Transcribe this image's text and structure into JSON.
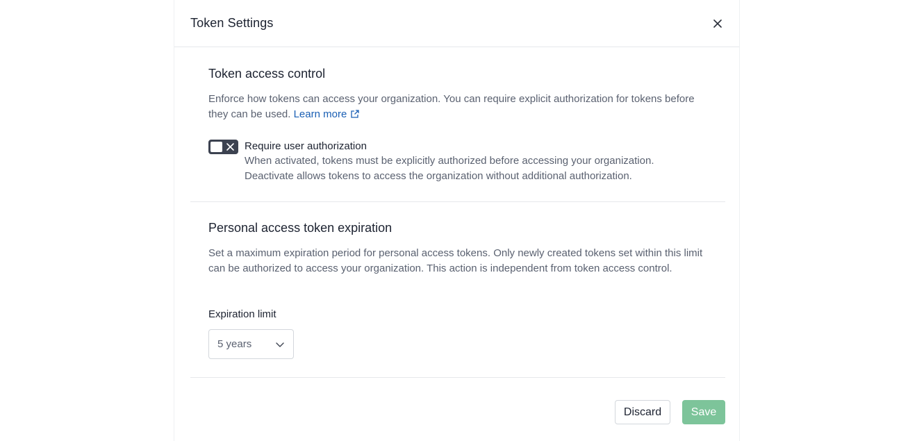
{
  "dialog": {
    "title": "Token Settings"
  },
  "token_access": {
    "heading": "Token access control",
    "description": "Enforce how tokens can access your organization. You can require explicit authorization for tokens before they can be used.",
    "learn_more": "Learn more",
    "toggle": {
      "label": "Require user authorization",
      "help_line1": "When activated, tokens must be explicitly authorized before accessing your organization.",
      "help_line2": "Deactivate allows tokens to access the organization without additional authorization.",
      "state": "off"
    }
  },
  "expiration": {
    "heading": "Personal access token expiration",
    "description": "Set a maximum expiration period for personal access tokens. Only newly created tokens set within this limit can be authorized to access your organization. This action is independent from token access control.",
    "field_label": "Expiration limit",
    "selected_value": "5 years"
  },
  "footer": {
    "discard_label": "Discard",
    "save_label": "Save"
  },
  "colors": {
    "link": "#1a5fb4",
    "save_button": "#7dc49a",
    "toggle_track": "#3c4250"
  },
  "icons": {
    "close": "close-icon",
    "external_link": "external-link-icon",
    "toggle_off": "x-icon",
    "dropdown": "chevron-down-icon"
  }
}
